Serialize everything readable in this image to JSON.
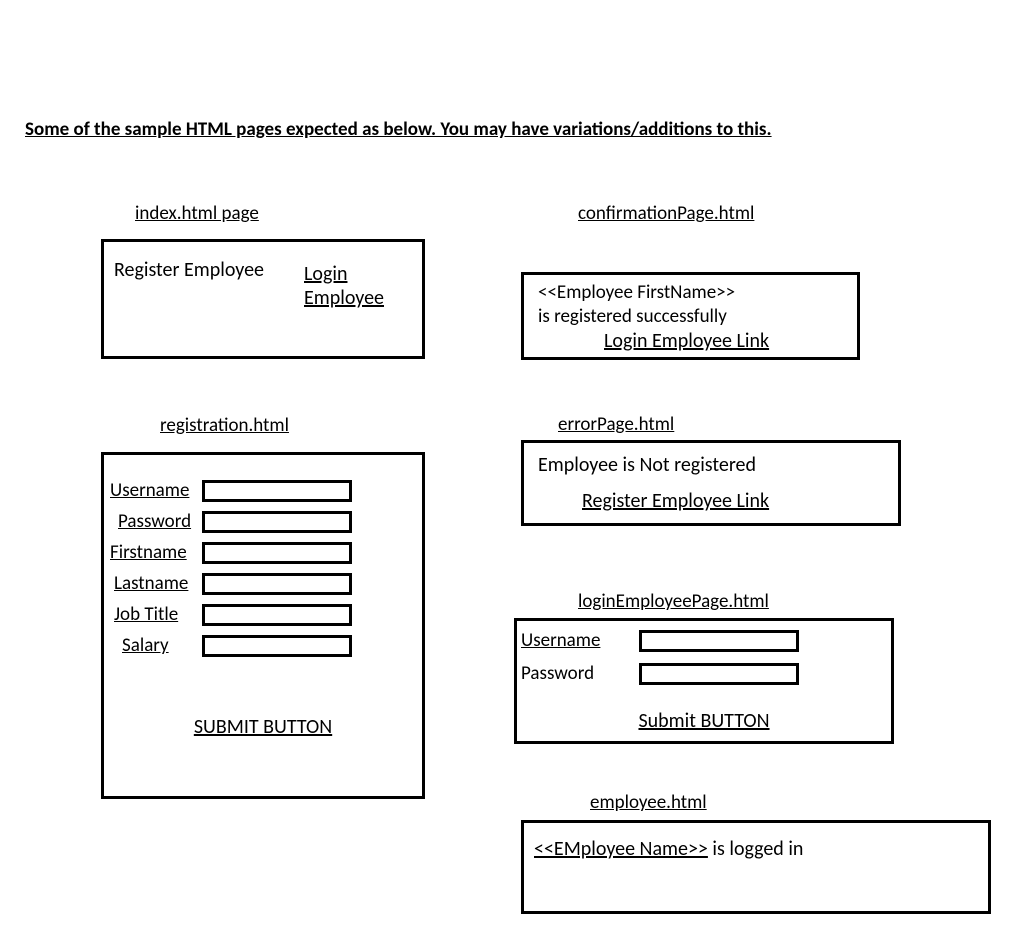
{
  "heading": "Some of the sample HTML pages expected as below. You may have variations/additions to this.",
  "index": {
    "title": "index.html page",
    "register": "Register Employee",
    "login": "Login Employee"
  },
  "confirmation": {
    "title": "confirmationPage.html",
    "line1": "<<Employee FirstName>>",
    "line2": "is registered successfully",
    "loginLink": "Login Employee Link"
  },
  "registration": {
    "title": "registration.html",
    "fields": {
      "username": "Username",
      "password": "Password",
      "firstname": "Firstname",
      "lastname": "Lastname",
      "jobtitle": "Job Title",
      "salary": "Salary"
    },
    "submit": "SUBMIT BUTTON"
  },
  "errorPage": {
    "title": "errorPage.html",
    "message": "Employee  is Not registered",
    "registerLink": "Register Employee Link"
  },
  "loginPage": {
    "title": "loginEmployeePage.html",
    "username": "Username",
    "password": "Password",
    "submit": "Submit BUTTON"
  },
  "employeePage": {
    "title": "employee.html",
    "namePlaceholder": "<<EMployee Name>>",
    "suffix": " is logged in"
  }
}
